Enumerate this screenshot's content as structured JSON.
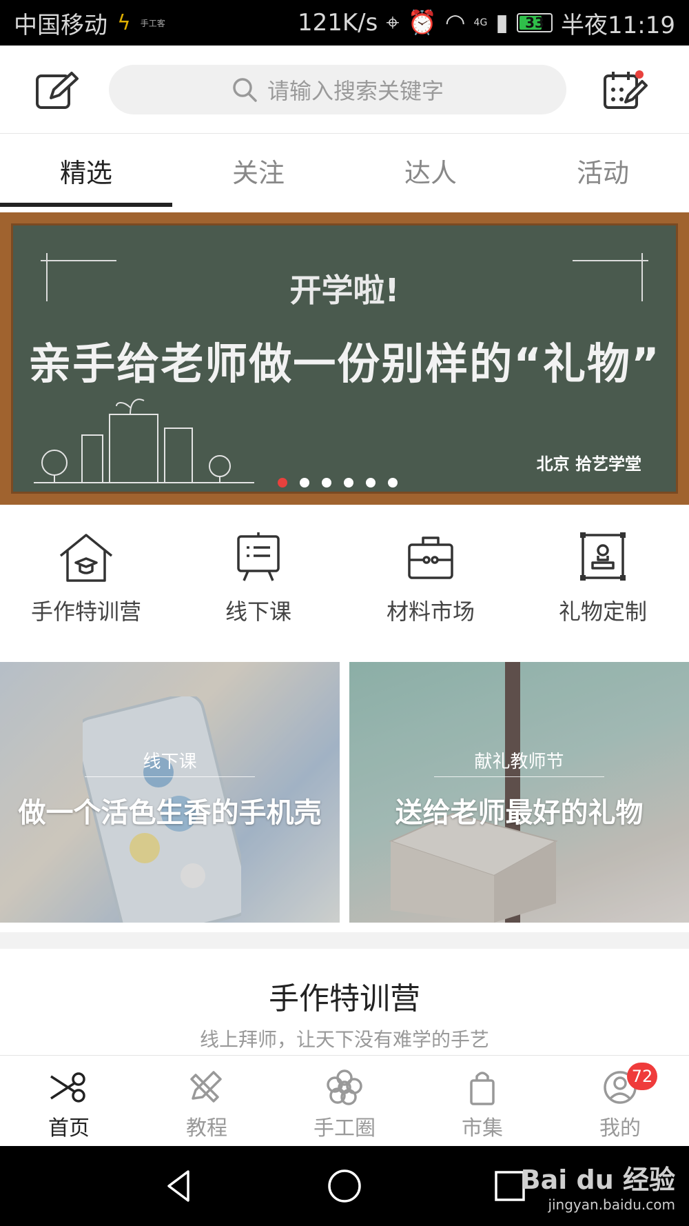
{
  "status_bar": {
    "carrier": "中国移动",
    "app_hint": "手工客",
    "speed": "121K/s",
    "network": "4G",
    "battery": "33",
    "time": "半夜11:19"
  },
  "header": {
    "search_placeholder": "请输入搜索关键字"
  },
  "tabs": [
    {
      "label": "精选",
      "active": true
    },
    {
      "label": "关注",
      "active": false
    },
    {
      "label": "达人",
      "active": false
    },
    {
      "label": "活动",
      "active": false
    }
  ],
  "banner": {
    "small_text": "开学啦!",
    "title": "亲手给老师做一份别样的“礼物”",
    "sign": "北京 拾艺学堂",
    "slide_count": 6,
    "active_slide": 1
  },
  "categories": [
    {
      "label": "手作特训营",
      "icon": "house-cap-icon"
    },
    {
      "label": "线下课",
      "icon": "presentation-board-icon"
    },
    {
      "label": "材料市场",
      "icon": "toolbox-icon"
    },
    {
      "label": "礼物定制",
      "icon": "stamp-frame-icon"
    }
  ],
  "cards": [
    {
      "tag": "线下课",
      "title": "做一个活色生香的手机壳"
    },
    {
      "tag": "献礼教师节",
      "title": "送给老师最好的礼物"
    }
  ],
  "section": {
    "title": "手作特训营",
    "subtitle": "线上拜师，让天下没有难学的手艺"
  },
  "bottom_nav": [
    {
      "label": "首页",
      "icon": "scissors-icon",
      "active": true
    },
    {
      "label": "教程",
      "icon": "pencil-ruler-icon",
      "active": false
    },
    {
      "label": "手工圈",
      "icon": "flower-icon",
      "active": false
    },
    {
      "label": "市集",
      "icon": "shopping-bag-icon",
      "active": false
    },
    {
      "label": "我的",
      "icon": "user-icon",
      "active": false,
      "badge": "72"
    }
  ],
  "watermark": {
    "brand": "Bai du 经验",
    "url": "jingyan.baidu.com"
  },
  "colors": {
    "accent_red": "#e8413d",
    "badge_red": "#ef3b3b",
    "board_green": "#4a5a4e",
    "frame_brown": "#a0632f"
  }
}
